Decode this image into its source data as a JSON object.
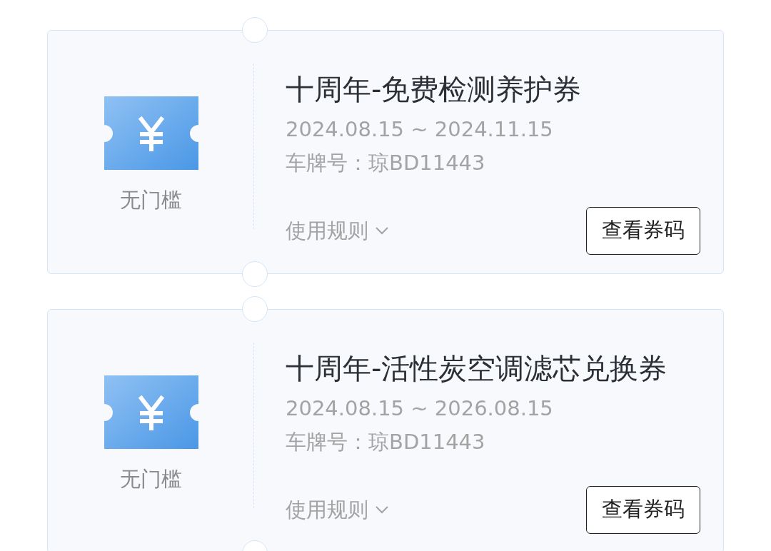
{
  "coupons": [
    {
      "badge": "无门槛",
      "title": "十周年-免费检测养护券",
      "validity": "2024.08.15 ~ 2024.11.15",
      "plate": "车牌号：琼BD11443",
      "rules_link": "使用规则",
      "button": "查看券码"
    },
    {
      "badge": "无门槛",
      "title": "十周年-活性炭空调滤芯兑换券",
      "validity": "2024.08.15 ~ 2026.08.15",
      "plate": "车牌号：琼BD11443",
      "rules_link": "使用规则",
      "button": "查看券码"
    }
  ]
}
